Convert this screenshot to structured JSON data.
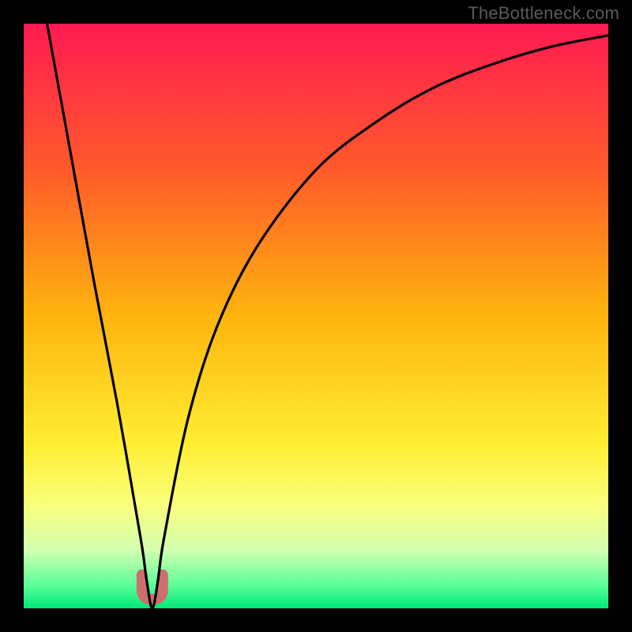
{
  "watermark": "TheBottleneck.com",
  "chart_data": {
    "type": "line",
    "title": "",
    "xlabel": "",
    "ylabel": "",
    "xlim": [
      0,
      100
    ],
    "ylim": [
      0,
      100
    ],
    "legend": false,
    "grid": false,
    "series": [
      {
        "name": "bottleneck-curve",
        "x": [
          4,
          8,
          12,
          16,
          20,
          21,
          22,
          23,
          24,
          28,
          33,
          40,
          50,
          60,
          70,
          80,
          90,
          100
        ],
        "values": [
          100,
          78,
          56,
          35,
          12,
          5,
          0,
          5,
          12,
          32,
          48,
          62,
          75,
          83,
          89,
          93,
          96,
          98
        ]
      }
    ],
    "annotations": [
      {
        "type": "curve-minimum-marker",
        "x": 22,
        "y": 3,
        "color": "#cc6f6c"
      }
    ],
    "background_gradient": {
      "stops": [
        {
          "pos": 0.0,
          "color": "#ff1a52"
        },
        {
          "pos": 0.25,
          "color": "#ff5a2a"
        },
        {
          "pos": 0.5,
          "color": "#ffb40e"
        },
        {
          "pos": 0.72,
          "color": "#ffee32"
        },
        {
          "pos": 0.82,
          "color": "#faff7a"
        },
        {
          "pos": 0.9,
          "color": "#d3ffb0"
        },
        {
          "pos": 0.96,
          "color": "#5cff9a"
        },
        {
          "pos": 1.0,
          "color": "#00e878"
        }
      ]
    }
  }
}
